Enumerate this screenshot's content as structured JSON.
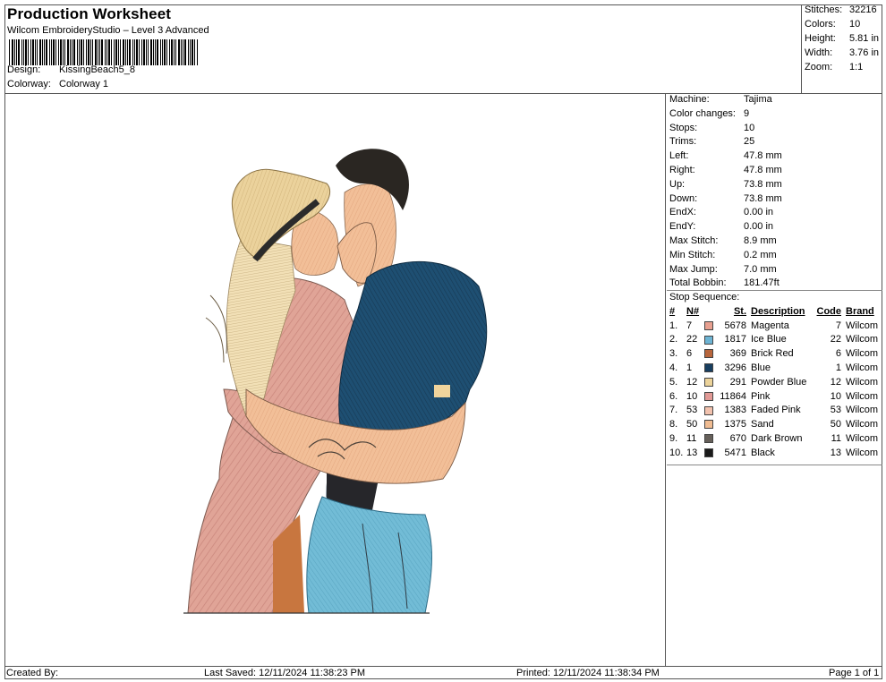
{
  "header": {
    "title": "Production Worksheet",
    "subtitle": "Wilcom EmbroideryStudio – Level 3 Advanced",
    "design_label": "Design:",
    "design_value": "KissingBeach5_8",
    "colorway_label": "Colorway:",
    "colorway_value": "Colorway 1"
  },
  "stats": [
    {
      "label": "Stitches:",
      "value": "32216"
    },
    {
      "label": "Colors:",
      "value": "10"
    },
    {
      "label": "Height:",
      "value": "5.81 in"
    },
    {
      "label": "Width:",
      "value": "3.76 in"
    },
    {
      "label": "Zoom:",
      "value": "1:1"
    }
  ],
  "machine_info": [
    {
      "label": "Machine:",
      "value": "Tajima"
    },
    {
      "label": "Color changes:",
      "value": "9"
    },
    {
      "label": "Stops:",
      "value": "10"
    },
    {
      "label": "Trims:",
      "value": "25"
    },
    {
      "label": "Left:",
      "value": "47.8 mm"
    },
    {
      "label": "Right:",
      "value": "47.8 mm"
    },
    {
      "label": "Up:",
      "value": "73.8 mm"
    },
    {
      "label": "Down:",
      "value": "73.8 mm"
    },
    {
      "label": "EndX:",
      "value": "0.00 in"
    },
    {
      "label": "EndY:",
      "value": "0.00 in"
    },
    {
      "label": "Max Stitch:",
      "value": "8.9 mm"
    },
    {
      "label": "Min Stitch:",
      "value": "0.2 mm"
    },
    {
      "label": "Max Jump:",
      "value": "7.0 mm"
    },
    {
      "label": "Total Bobbin:",
      "value": "181.47ft"
    }
  ],
  "stop_sequence": {
    "title": "Stop Sequence:",
    "headers": {
      "idx": "#",
      "n": "N#",
      "st": "St.",
      "desc": "Description",
      "code": "Code",
      "brand": "Brand"
    },
    "rows": [
      {
        "idx": "1.",
        "n": "7",
        "color": "#e8a090",
        "st": "5678",
        "desc": "Magenta",
        "code": "7",
        "brand": "Wilcom"
      },
      {
        "idx": "2.",
        "n": "22",
        "color": "#6db4d4",
        "st": "1817",
        "desc": "Ice Blue",
        "code": "22",
        "brand": "Wilcom"
      },
      {
        "idx": "3.",
        "n": "6",
        "color": "#b8663c",
        "st": "369",
        "desc": "Brick Red",
        "code": "6",
        "brand": "Wilcom"
      },
      {
        "idx": "4.",
        "n": "1",
        "color": "#173e60",
        "st": "3296",
        "desc": "Blue",
        "code": "1",
        "brand": "Wilcom"
      },
      {
        "idx": "5.",
        "n": "12",
        "color": "#ecd39a",
        "st": "291",
        "desc": "Powder Blue",
        "code": "12",
        "brand": "Wilcom"
      },
      {
        "idx": "6.",
        "n": "10",
        "color": "#e29a96",
        "st": "11864",
        "desc": "Pink",
        "code": "10",
        "brand": "Wilcom"
      },
      {
        "idx": "7.",
        "n": "53",
        "color": "#f2c2ae",
        "st": "1383",
        "desc": "Faded Pink",
        "code": "53",
        "brand": "Wilcom"
      },
      {
        "idx": "8.",
        "n": "50",
        "color": "#f0bc92",
        "st": "1375",
        "desc": "Sand",
        "code": "50",
        "brand": "Wilcom"
      },
      {
        "idx": "9.",
        "n": "11",
        "color": "#66605a",
        "st": "670",
        "desc": "Dark Brown",
        "code": "11",
        "brand": "Wilcom"
      },
      {
        "idx": "10.",
        "n": "13",
        "color": "#1a1a1a",
        "st": "5471",
        "desc": "Black",
        "code": "13",
        "brand": "Wilcom"
      }
    ]
  },
  "footer": {
    "created_by": "Created By:",
    "last_saved": "Last Saved: 12/11/2024 11:38:23 PM",
    "printed": "Printed: 12/11/2024 11:38:34 PM",
    "page": "Page 1 of 1"
  }
}
